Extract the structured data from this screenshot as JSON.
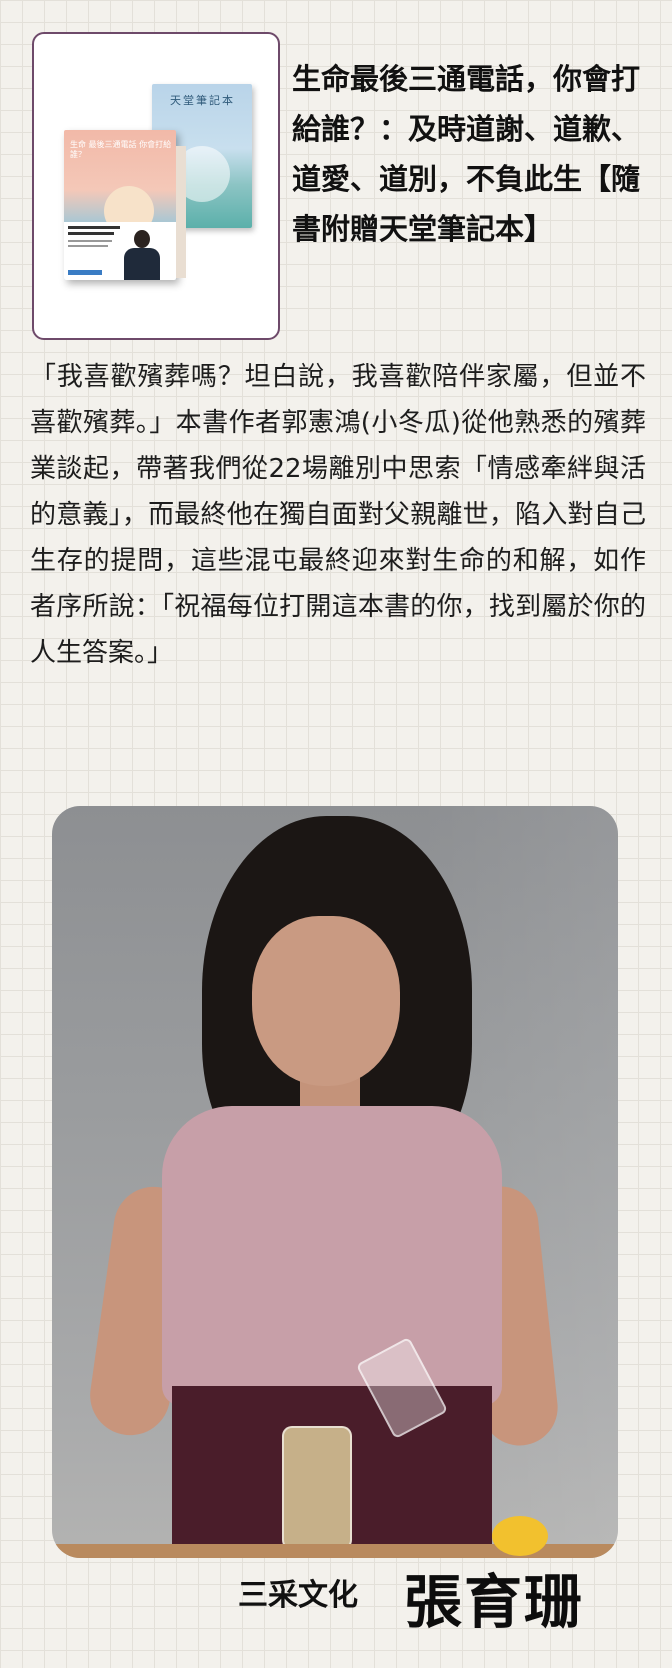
{
  "book": {
    "title": "生命最後三通電話，你會打給誰？：及時道謝、道歉、道愛、道別，不負此生【隨書附贈天堂筆記本】",
    "cover_front_title": "生命 最後三通電話 你會打給誰？",
    "cover_back_title": "天堂筆記本"
  },
  "description": "「我喜歡殯葬嗎？坦白說，我喜歡陪伴家屬，但並不喜歡殯葬。」本書作者郭憲鴻(小冬瓜)從他熟悉的殯葬業談起，帶著我們從22場離別中思索「情感牽絆與活的意義」，而最終他在獨自面對父親離世，陷入對自己生存的提問，這些混屯最終迎來對生命的和解，如作者序所說：「祝福每位打開這本書的你，找到屬於你的人生答案。」",
  "footer": {
    "publisher": "三采文化",
    "name": "張育珊"
  },
  "colors": {
    "background": "#f3f1ec",
    "grid": "#e3e0d9",
    "card_border": "#6e4a6a"
  }
}
